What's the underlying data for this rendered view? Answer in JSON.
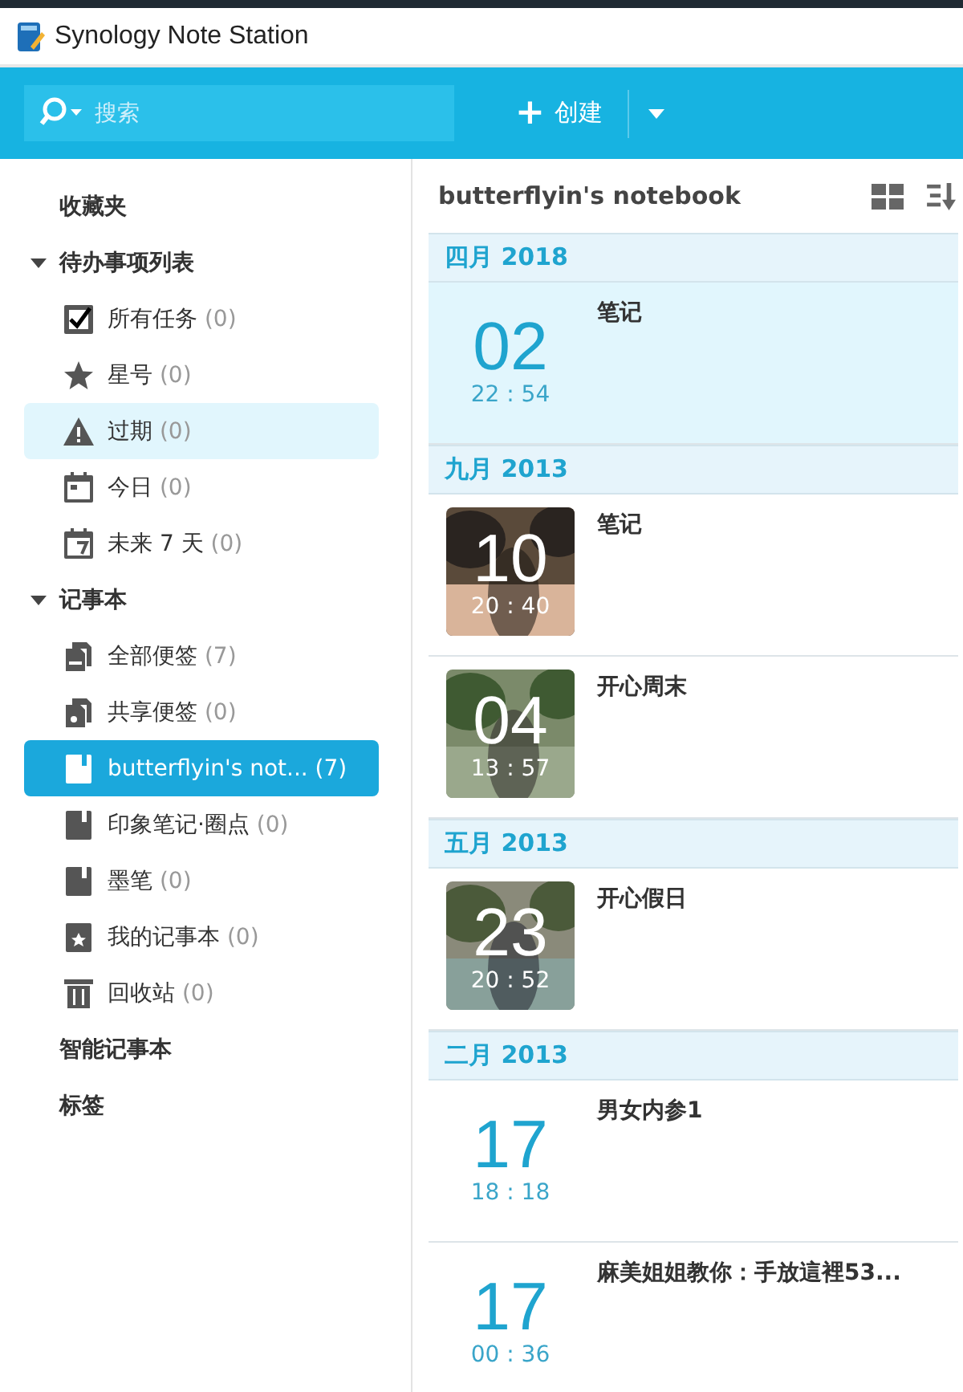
{
  "window": {
    "title": "Synology Note Station"
  },
  "toolbar": {
    "search": {
      "placeholder": "搜索"
    },
    "create_button": {
      "icon": "+",
      "label": "创建"
    }
  },
  "sidebar": {
    "sections": [
      {
        "label": "收藏夹"
      },
      {
        "label": "待办事项列表",
        "expanded": true,
        "items": [
          {
            "kind": "check",
            "label": "所有任务",
            "count": "(0)",
            "selected": false,
            "highlighted": false
          },
          {
            "kind": "star",
            "label": "星号",
            "count": "(0)",
            "selected": false,
            "highlighted": false
          },
          {
            "kind": "warning",
            "label": "过期",
            "count": "(0)",
            "selected": false,
            "highlighted": true
          },
          {
            "kind": "calendar",
            "label": "今日",
            "count": "(0)",
            "selected": false,
            "highlighted": false
          },
          {
            "kind": "calendar7",
            "label": "未来 7 天",
            "count": "(0)",
            "selected": false,
            "highlighted": false
          }
        ]
      },
      {
        "label": "记事本",
        "expanded": true,
        "items": [
          {
            "kind": "notes",
            "label": "全部便签",
            "count": "(7)",
            "selected": false,
            "highlighted": false
          },
          {
            "kind": "shared",
            "label": "共享便签",
            "count": "(0)",
            "selected": false,
            "highlighted": false
          },
          {
            "kind": "notebook",
            "label": "butterflyin's not...",
            "count": "(7)",
            "selected": true,
            "highlighted": false
          },
          {
            "kind": "notebook",
            "label": "印象笔记·圈点",
            "count": "(0)",
            "selected": false,
            "highlighted": false
          },
          {
            "kind": "notebook",
            "label": "墨笔",
            "count": "(0)",
            "selected": false,
            "highlighted": false
          },
          {
            "kind": "notebook-star",
            "label": "我的记事本",
            "count": "(0)",
            "selected": false,
            "highlighted": false
          },
          {
            "kind": "trash",
            "label": "回收站",
            "count": "(0)",
            "selected": false,
            "highlighted": false
          }
        ]
      },
      {
        "label": "智能记事本"
      },
      {
        "label": "标签"
      }
    ]
  },
  "notes_pane": {
    "title": "butterflyin's notebook",
    "groups": [
      {
        "month": "四月 2018",
        "notes": [
          {
            "day": "02",
            "time": "22 : 54",
            "title": "笔记",
            "selected": true
          }
        ]
      },
      {
        "month": "九月 2013",
        "notes": [
          {
            "day": "10",
            "time": "20 : 40",
            "title": "笔记",
            "selected": false
          },
          {
            "day": "04",
            "time": "13 : 57",
            "title": "开心周末",
            "selected": false
          }
        ]
      },
      {
        "month": "五月 2013",
        "notes": [
          {
            "day": "23",
            "time": "20 : 52",
            "title": "开心假日",
            "selected": false
          }
        ]
      },
      {
        "month": "二月 2013",
        "notes": [
          {
            "day": "17",
            "time": "18 : 18",
            "title": "男女内参1",
            "selected": false
          },
          {
            "day": "17",
            "time": "00 : 36",
            "title": "麻美姐姐教你：手放這裡53...",
            "selected": false
          }
        ]
      }
    ]
  }
}
